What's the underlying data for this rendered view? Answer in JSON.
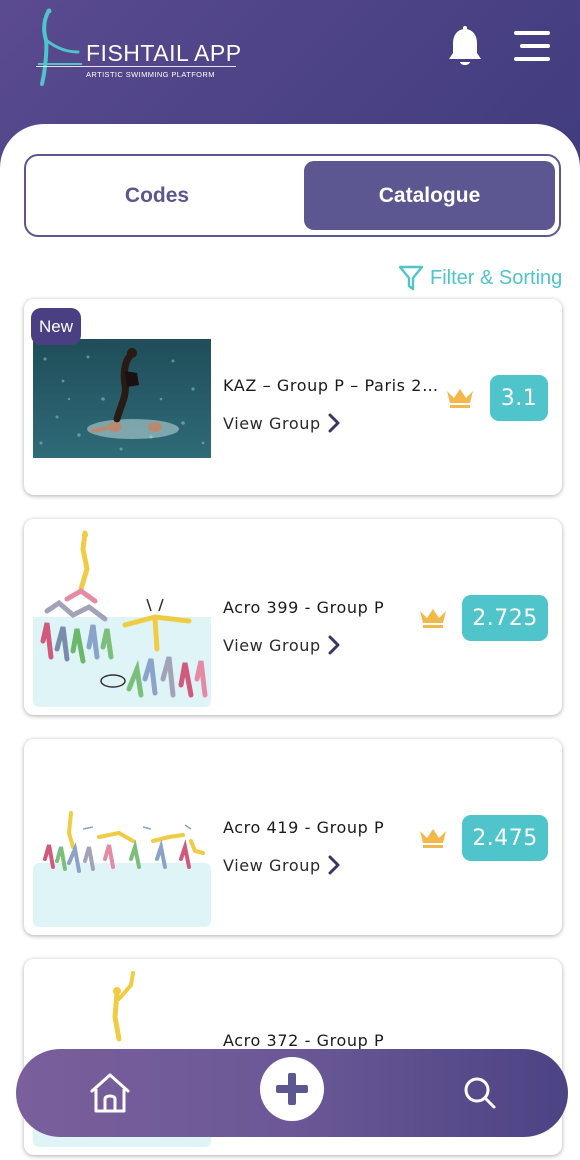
{
  "header": {
    "app_name": "FISHTAIL APP",
    "tagline": "ARTISTIC SWIMMING PLATFORM",
    "icons": {
      "notifications": "bell-icon",
      "menu": "hamburger-menu-icon"
    }
  },
  "tabs": {
    "codes": "Codes",
    "catalogue": "Catalogue",
    "selected": "Catalogue"
  },
  "filter": {
    "label": "Filter & Sorting",
    "icon": "filter-funnel-icon"
  },
  "cards": [
    {
      "badge": "New",
      "title": "KAZ – Group P – Paris 2…",
      "link": "View Group",
      "score": "3.1",
      "icon": "crown-icon",
      "image": "photo"
    },
    {
      "title": "Acro 399 - Group P",
      "link": "View Group",
      "score": "2.725",
      "icon": "crown-icon",
      "image": "illustration"
    },
    {
      "title": "Acro 419 - Group P",
      "link": "View Group",
      "score": "2.475",
      "icon": "crown-icon",
      "image": "illustration"
    },
    {
      "title": "Acro 372 - Group P",
      "link": "View Group",
      "score": "",
      "icon": "crown-icon",
      "image": "illustration"
    }
  ],
  "bottom_nav": {
    "items": [
      "home-icon",
      "plus-icon",
      "search-icon"
    ]
  },
  "colors": {
    "primary": "#5c5691",
    "accent": "#4fc4ca",
    "crown": "#f2b84b",
    "badge": "#4a3f82"
  }
}
